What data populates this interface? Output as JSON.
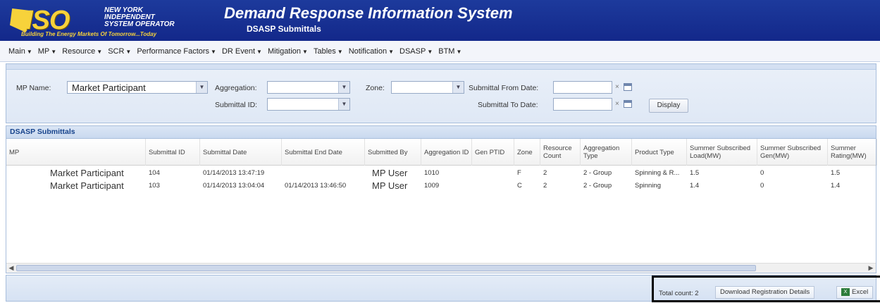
{
  "header": {
    "logo_text": "ISO",
    "logo_lines": [
      "NEW YORK",
      "INDEPENDENT",
      "SYSTEM OPERATOR"
    ],
    "logo_tagline": "Building The Energy Markets Of Tomorrow...Today",
    "title": "Demand Response Information System",
    "subtitle": "DSASP Submittals"
  },
  "menu": [
    {
      "label": "Main"
    },
    {
      "label": "MP"
    },
    {
      "label": "Resource"
    },
    {
      "label": "SCR"
    },
    {
      "label": "Performance Factors"
    },
    {
      "label": "DR Event"
    },
    {
      "label": "Mitigation"
    },
    {
      "label": "Tables"
    },
    {
      "label": "Notification"
    },
    {
      "label": "DSASP"
    },
    {
      "label": "BTM"
    }
  ],
  "filters": {
    "mp_name_label": "MP Name:",
    "mp_name_value": "Market Participant",
    "aggregation_label": "Aggregation:",
    "aggregation_value": "",
    "zone_label": "Zone:",
    "zone_value": "",
    "submittal_from_label": "Submittal From Date:",
    "submittal_from_value": "",
    "submittal_id_label": "Submittal ID:",
    "submittal_id_value": "",
    "submittal_to_label": "Submittal To Date:",
    "submittal_to_value": "",
    "clear_glyph": "×",
    "display_button": "Display"
  },
  "grid": {
    "title": "DSASP Submittals",
    "columns": [
      "MP",
      "Submittal ID",
      "Submittal Date",
      "Submittal End Date",
      "Submitted By",
      "Aggregation ID",
      "Gen PTID",
      "Zone",
      "Resource Count",
      "Aggregation Type",
      "Product Type",
      "Summer Subscribed Load(MW)",
      "Summer Subscribed Gen(MW)",
      "Summer Rating(MW)"
    ],
    "rows": [
      [
        "Market Participant",
        "104",
        "01/14/2013 13:47:19",
        "",
        "MP User",
        "1010",
        "",
        "F",
        "2",
        "2 - Group",
        "Spinning & R...",
        "1.5",
        "0",
        "1.5"
      ],
      [
        "Market Participant",
        "103",
        "01/14/2013 13:04:04",
        "01/14/2013 13:46:50",
        "MP User",
        "1009",
        "",
        "C",
        "2",
        "2 - Group",
        "Spinning",
        "1.4",
        "0",
        "1.4"
      ]
    ]
  },
  "footer": {
    "total_count": "Total count: 2",
    "download_button": "Download Registration Details",
    "excel_button": "Excel"
  }
}
